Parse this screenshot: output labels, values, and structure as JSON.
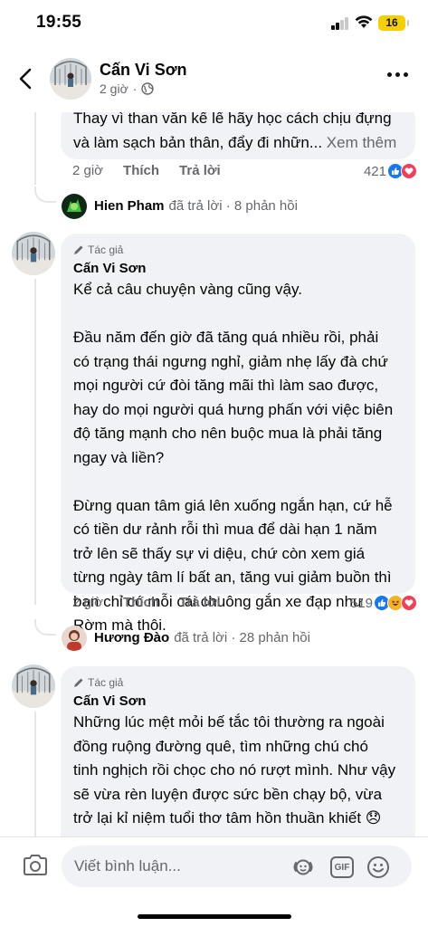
{
  "status_bar": {
    "time": "19:55",
    "battery": "16"
  },
  "header": {
    "name": "Cấn Vi Sơn",
    "time": "2 giờ",
    "privacy_icon": "globe-icon"
  },
  "top_comment": {
    "text": "Thay vì than văn kể lể hãy học cách chịu đựng\nvà làm sạch bản thân, đẩy đi nhữn... ",
    "see_more": "Xem thêm",
    "time": "2 giờ",
    "like": "Thích",
    "reply": "Trả lời",
    "reaction_count": "421",
    "reactions": [
      "like",
      "love"
    ]
  },
  "reply_summary_1": {
    "name": "Hien Pham",
    "text": "đã trả lời · 8 phản hồi"
  },
  "comment_1": {
    "badge": "Tác giả",
    "author": "Cấn Vi Sơn",
    "text": "Kể cả câu chuyện vàng cũng vậy.\n\nĐầu năm đến giờ đã tăng quá nhiều rồi, phải\ncó trạng thái ngưng nghỉ, giảm nhẹ lấy đà chứ\nmọi người cứ đòi tăng mãi thì làm sao được,\nhay do mọi người quá hưng phấn với việc biên\nđộ tăng mạnh cho nên buộc mua là phải tăng\nngay và liền?\n\nĐừng quan tâm giá lên xuống ngắn hạn, cứ hễ\ncó tiền dư rảnh rỗi thì mua để dài hạn 1 năm\ntrở lên sẽ thấy sự vi diệu, chứ còn xem giá\ntừng ngày tâm lí bất an, tăng vui giảm buồn thì\nbạn chỉ có mỗi cái chuông gắn xe đạp như\nRờm mà thôi.",
    "time": "2 giờ",
    "like": "Thích",
    "reply": "Trả lời",
    "reaction_count": "519",
    "reactions": [
      "like",
      "haha",
      "love"
    ]
  },
  "reply_summary_2": {
    "name": "Hương Đào",
    "text": "đã trả lời · 28 phản hồi"
  },
  "comment_2": {
    "badge": "Tác giả",
    "author": "Cấn Vi Sơn",
    "text": "Những lúc mệt mỏi bế tắc tôi thường ra ngoài\nđồng ruộng đường quê, tìm những chú chó\ntinh nghịch rồi chọc cho nó rượt mình. Như vậy\nsẽ vừa rèn luyện được sức bền chạy bộ, vừa\ntrở lại kỉ niệm tuổi thơ tâm hồn thuần khiết 😞"
  },
  "composer": {
    "placeholder": "Viết bình luận...",
    "gif_label": "GIF"
  },
  "colors": {
    "accent": "#1877f2",
    "love": "#f33e58",
    "haha": "#f7b125",
    "bubble": "#f0f2f5",
    "muted": "#65676b"
  }
}
